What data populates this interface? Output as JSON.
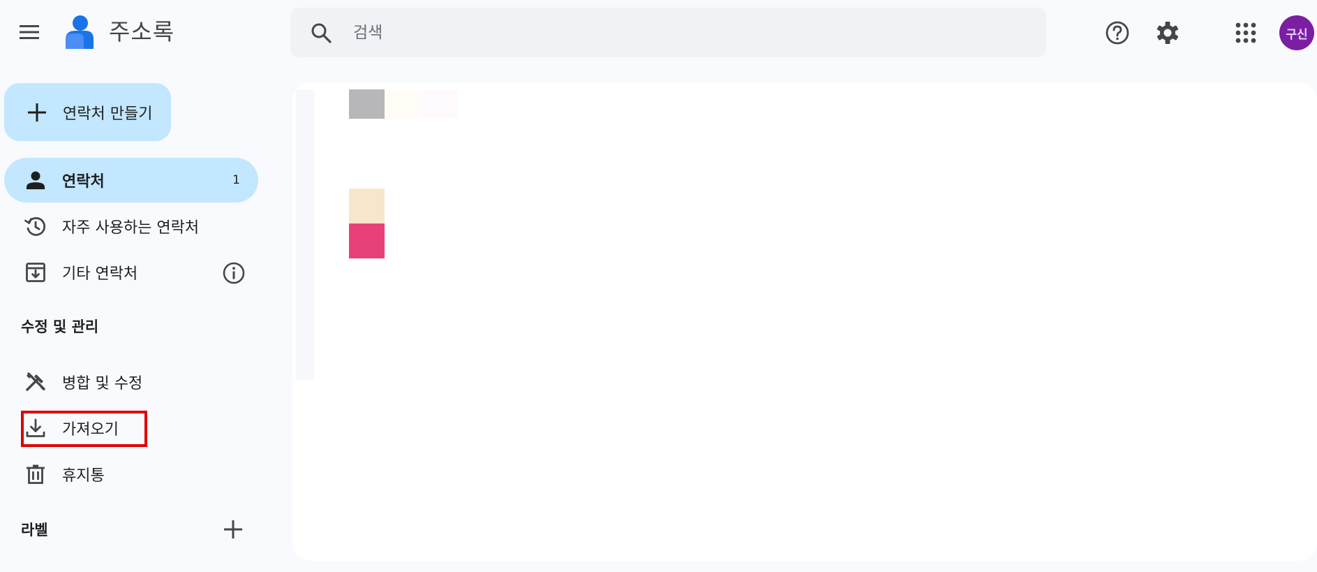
{
  "app": {
    "title": "주소록"
  },
  "search": {
    "placeholder": "검색"
  },
  "header": {
    "avatar_text": "구신"
  },
  "sidebar": {
    "create_label": "연락처 만들기",
    "items": [
      {
        "label": "연락처",
        "count": "1",
        "icon": "person-icon",
        "active": true
      },
      {
        "label": "자주 사용하는 연락처",
        "icon": "history-icon"
      },
      {
        "label": "기타 연락처",
        "icon": "archive-download-icon"
      }
    ],
    "section_manage": "수정 및 관리",
    "manage_items": [
      {
        "label": "병합 및 수정",
        "icon": "tools-icon"
      },
      {
        "label": "가져오기",
        "icon": "download-icon"
      },
      {
        "label": "휴지통",
        "icon": "trash-icon"
      }
    ],
    "section_labels": "라벨"
  },
  "colors": {
    "accent": "#c2e7ff",
    "avatar": "#7b1fa2",
    "highlight": "#e00000",
    "swatch_gray": "#b7b7b9",
    "swatch_beige": "#f7e6cb",
    "swatch_pink": "#e8417a"
  }
}
